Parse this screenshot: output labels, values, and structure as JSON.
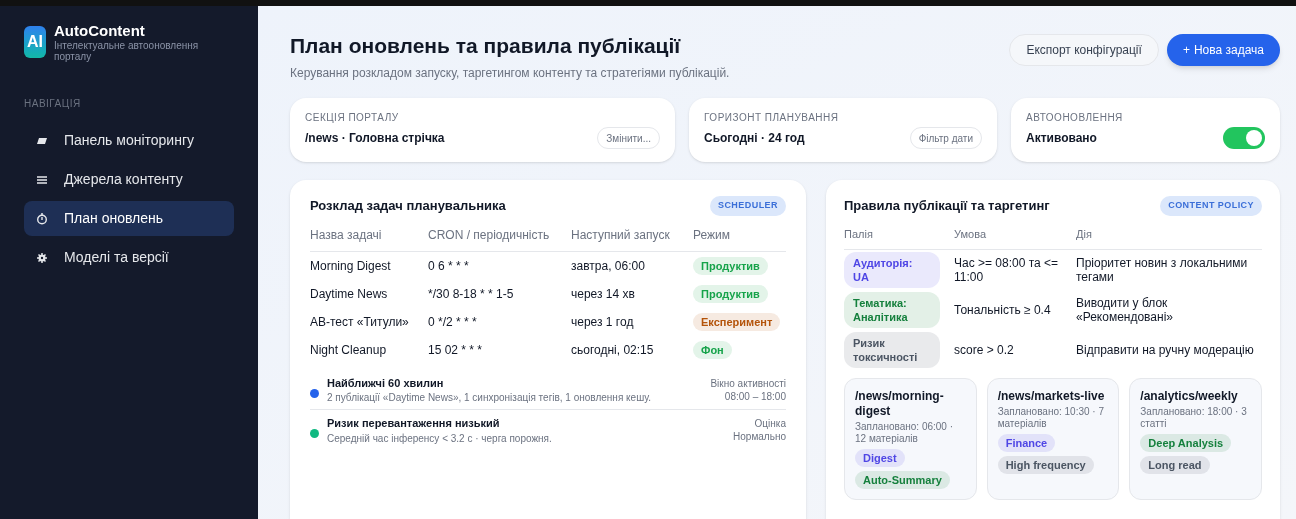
{
  "brand": {
    "logo": "AI",
    "name": "AutoContent",
    "tagline": "Інтелектуальне автооновлення порталу"
  },
  "sidebar": {
    "section": "НАВІГАЦІЯ",
    "items": [
      {
        "label": "Панель моніторингу",
        "selected": false
      },
      {
        "label": "Джерела контенту",
        "selected": false
      },
      {
        "label": "План оновлень",
        "selected": true
      },
      {
        "label": "Моделі та версії",
        "selected": false
      }
    ]
  },
  "header": {
    "title": "План оновлень та правила публікації",
    "subtitle": "Керування розкладом запуску, таргетингом контенту та стратегіями публікацій.",
    "export_button": "Експорт конфігурації",
    "new_button_icon": "+",
    "new_button": "Нова задача"
  },
  "filters": [
    {
      "kind": "select",
      "label": "СЕКЦІЯ ПОРТАЛУ",
      "value": "/news · Головна стрічка",
      "button": "Змінити..."
    },
    {
      "kind": "select",
      "label": "ГОРИЗОНТ ПЛАНУВАННЯ",
      "value": "Сьогодні · 24 год",
      "button": "Фільтр дати"
    },
    {
      "kind": "toggle",
      "label": "АВТООНОВЛЕННЯ",
      "value": "Активовано",
      "on": true
    }
  ],
  "scheduler": {
    "title": "Розклад задач планувальника",
    "badge": "SCHEDULER",
    "columns": [
      "Назва задачі",
      "CRON / періодичність",
      "Наступний запуск",
      "Режим"
    ],
    "rows": [
      {
        "name": "Morning Digest",
        "cron": "0 6 * * *",
        "next": "завтра, 06:00",
        "mode": "Продуктив",
        "color": "#16a34a"
      },
      {
        "name": "Daytime News",
        "cron": "*/30 8-18 * * 1-5",
        "next": "через 14 хв",
        "mode": "Продуктив",
        "color": "#16a34a"
      },
      {
        "name": "AB-тест «Титули»",
        "cron": "0 */2 * * *",
        "next": "через 1 год",
        "mode": "Експеримент",
        "color": "#b45309"
      },
      {
        "name": "Night Cleanup",
        "cron": "15 02 * * *",
        "next": "сьогодні, 02:15",
        "mode": "Фон",
        "color": "#16a34a"
      }
    ],
    "events": [
      {
        "title": "Найближчі 60 хвилин",
        "text": "2 публікації «Daytime News», 1 синхронізація тегів, 1 оновлення кешу.",
        "side_label": "Вікно активності",
        "side_value": "08:00 – 18:00",
        "color": "#2563eb"
      },
      {
        "title": "Ризик перевантаження низький",
        "text": "Середній час інференсу < 3.2 с · черга порожня.",
        "side_label": "Оцінка",
        "side_value": "Нормально",
        "color": "#10b981"
      }
    ]
  },
  "policy": {
    "title": "Правила публікації та таргетинг",
    "badge": "CONTENT POLICY",
    "columns": [
      "Палія",
      "Умова",
      "Дія"
    ],
    "rows": [
      {
        "tag": "Аудиторія: UA",
        "color": "#4f46e5",
        "condition": "Час >= 08:00 та <= 11:00",
        "action": "Пріоритет новин з локальними тегами"
      },
      {
        "tag": "Тематика: Аналітика",
        "color": "#15803d",
        "condition": "Тональність ≥ 0.4",
        "action": "Виводити у блок «Рекомендовані»"
      },
      {
        "tag": "Ризик токсичності",
        "color": "#4b5563",
        "condition": "score > 0.2",
        "action": "Відправити на ручну модерацію"
      }
    ],
    "cards": [
      {
        "path": "/news/morning-digest",
        "info": "Заплановано: 06:00 · 12 матеріалів",
        "tags": [
          {
            "label": "Digest",
            "color": "#4f46e5"
          },
          {
            "label": "Auto-Summary",
            "color": "#15803d"
          }
        ]
      },
      {
        "path": "/news/markets-live",
        "info": "Заплановано: 10:30 · 7 матеріалів",
        "tags": [
          {
            "label": "Finance",
            "color": "#4f46e5"
          },
          {
            "label": "High frequency",
            "color": "#4b5563"
          }
        ]
      },
      {
        "path": "/analytics/weekly",
        "info": "Заплановано: 18:00 · 3 статті",
        "tags": [
          {
            "label": "Deep Analysis",
            "color": "#15803d"
          },
          {
            "label": "Long read",
            "color": "#4b5563"
          }
        ]
      }
    ]
  }
}
